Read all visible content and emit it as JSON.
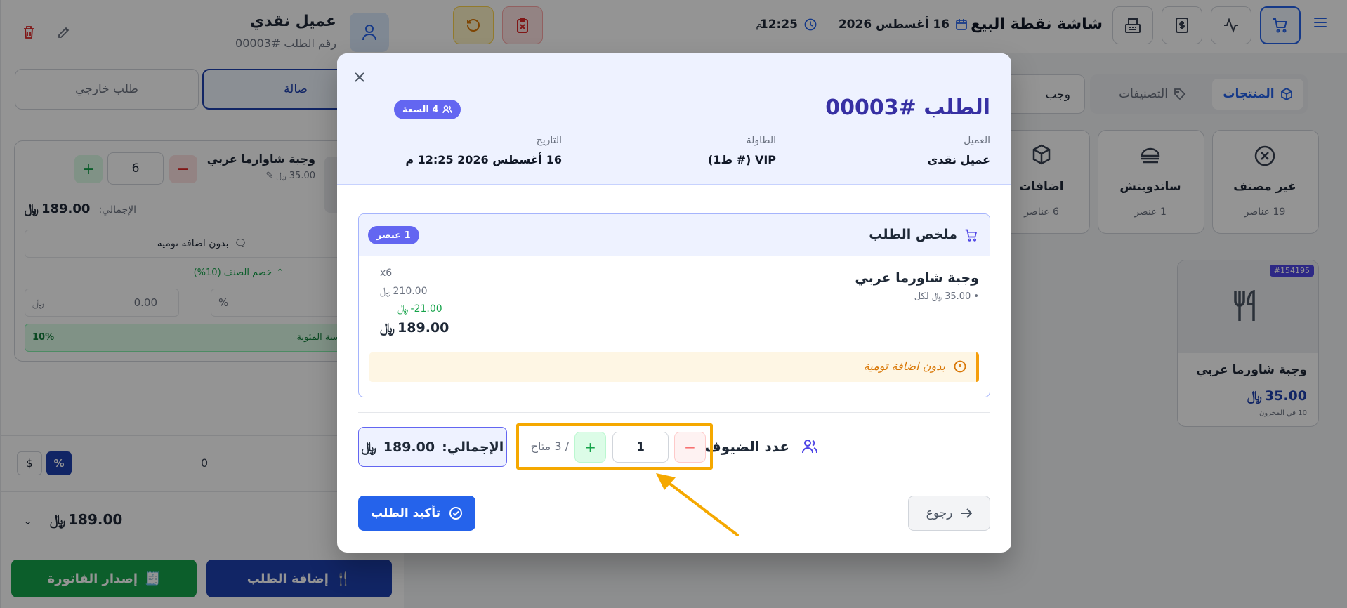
{
  "topbar": {
    "title": "شاشة نقطة البيع",
    "date": "16 أغسطس 2026",
    "time": "12:25",
    "time_suffix": "م"
  },
  "customer_panel": {
    "name": "عميل نقدي",
    "order_no": "رقم الطلب #00003",
    "tab_hall": "صالة",
    "tab_takeaway": "طلب خارجي",
    "item_name": "وجبة شاوارما عربي",
    "item_price": "35.00",
    "item_qty": "6",
    "total_label": "الإجمالي:",
    "total_value": "189.00",
    "note": "بدون اضافة تومية",
    "discount_label": "خصم الصنف (10%)",
    "discount_percent": "10",
    "discount_amount": "0.00",
    "pct_badge_label": "خصم النسبة المئوية",
    "pct_badge_value": "10%",
    "order_discount_value": "0",
    "grand_total": "189.00",
    "btn_invoice": "إصدار الفاتورة",
    "btn_add_order": "إضافة الطلب"
  },
  "catalog": {
    "tab_products": "المنتجات",
    "tab_categories": "التصنيفات",
    "search_value": "وجب",
    "categories": [
      {
        "name": "غير مصنف",
        "count": "19 عناصر"
      },
      {
        "name": "ساندويتش",
        "count": "1 عنصر"
      },
      {
        "name": "اضافات",
        "count": "6 عناصر"
      }
    ],
    "product": {
      "sku": "#154195",
      "name": "وجبة شاورما عربي",
      "price": "35.00",
      "stock": "10 في المخزون"
    }
  },
  "modal": {
    "title": "الطلب #00003",
    "cart_badge": "4 السعة",
    "customer_label": "العميل",
    "customer_value": "عميل نقدي",
    "table_label": "الطاولة",
    "table_value": "VIP (# ط1)",
    "date_label": "التاريخ",
    "date_value": "16 أغسطس 2026 12:25 م",
    "summary_title": "ملخص الطلب",
    "summary_count": "1 عنصر",
    "line": {
      "name": "وجبة شاورما عربي",
      "unit_price": "35.00",
      "unit_suffix": "لكل",
      "qty": "x6",
      "original": "210.00",
      "discount": "21.00-",
      "final": "189.00"
    },
    "note": "بدون اضافة تومية",
    "guests_label": "عدد الضيوف:",
    "guests_value": "1",
    "guests_available": "/ 3 متاح",
    "total_label": "الإجمالي:",
    "total_value": "189.00",
    "back_label": "رجوع",
    "confirm_label": "تأكيد الطلب"
  },
  "colors": {
    "primary": "#2563eb",
    "indigo": "#3730a3",
    "badge": "#6366f1",
    "green": "#16a34a",
    "red": "#dc2626",
    "highlight": "#f5a800"
  }
}
